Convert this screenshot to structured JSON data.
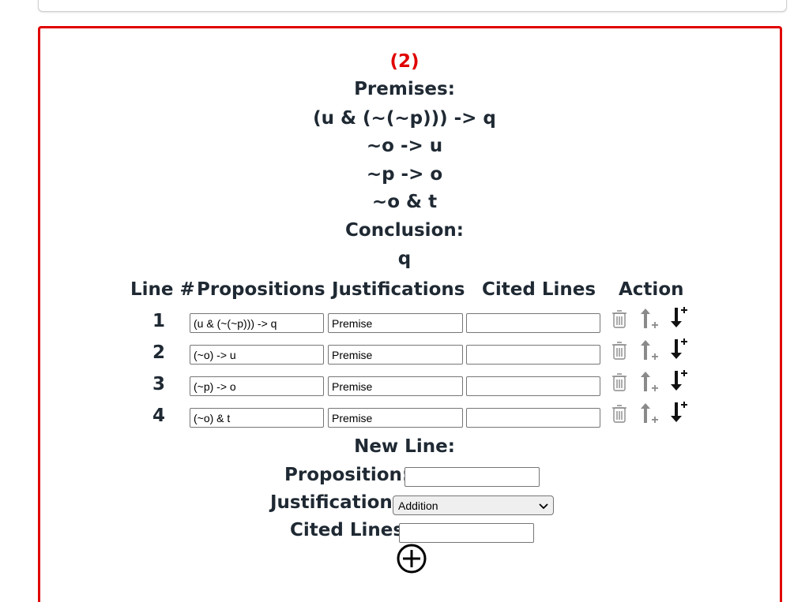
{
  "problem": {
    "number": "(2)",
    "premises_label": "Premises:",
    "premises": [
      "(u & (~(~p))) -> q",
      "~o -> u",
      "~p -> o",
      "~o & t"
    ],
    "conclusion_label": "Conclusion:",
    "conclusion": "q"
  },
  "table": {
    "headers": {
      "line": "Line #",
      "propositions": "Propositions",
      "justifications": "Justifications",
      "cited": "Cited Lines",
      "action": "Action"
    },
    "rows": [
      {
        "num": "1",
        "proposition": "(u & (~(~p))) -> q",
        "justification": "Premise",
        "cited": ""
      },
      {
        "num": "2",
        "proposition": "(~o) -> u",
        "justification": "Premise",
        "cited": ""
      },
      {
        "num": "3",
        "proposition": "(~p) -> o",
        "justification": "Premise",
        "cited": ""
      },
      {
        "num": "4",
        "proposition": "(~o) & t",
        "justification": "Premise",
        "cited": ""
      }
    ]
  },
  "new_line": {
    "title": "New Line:",
    "proposition_label": "Proposition:",
    "proposition_value": "",
    "justification_label": "Justification:",
    "justification_selected": "Addition",
    "cited_label": "Cited Lines:",
    "cited_value": ""
  },
  "icons": {
    "delete": "trash-icon",
    "move_up": "arrow-up-plus-icon",
    "insert_below": "arrow-down-plus-icon",
    "add": "circle-plus-icon"
  },
  "colors": {
    "accent": "#e00000",
    "text": "#1f2933",
    "icon_gray": "#8a8a8a"
  }
}
